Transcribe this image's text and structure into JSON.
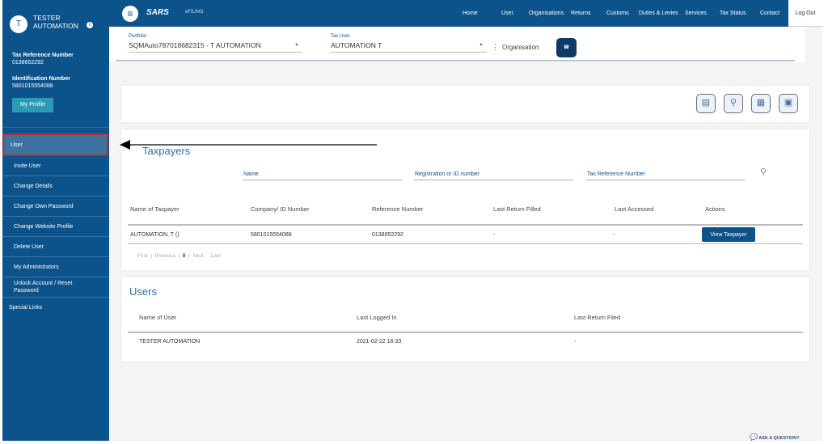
{
  "sidebar": {
    "avatar_letter": "T",
    "user_name_1": "TESTER",
    "user_name_2": "AUTOMATION",
    "tax_ref_label": "Tax Reference Number",
    "tax_ref": "0138652292",
    "id_label": "Identification Number",
    "id_number": "5801015554088",
    "profile_button": "My Profile",
    "active_item": "User",
    "items": [
      "Invite User",
      "Change Details",
      "Change Own Password",
      "Change Website Profile",
      "Delete User",
      "My Administrators",
      "Unlock Account / Reset Password",
      "Special Links"
    ]
  },
  "topbar": {
    "logo": "SARS",
    "efiling": "eFILING",
    "nav": [
      "Home",
      "User",
      "Organisations",
      "Returns",
      "Customs",
      "Duties & Levies",
      "Services",
      "Tax Status",
      "Contact"
    ],
    "logout": "Log Out"
  },
  "filters": {
    "portfolio_label": "Portfolio",
    "portfolio_value": "SQMAuto787018682315 - T AUTOMATION",
    "tax_user_label": "Tax User",
    "tax_user_value": "AUTOMATION T",
    "organisation": "Organisation"
  },
  "taxpayers": {
    "title": "Taxpayers",
    "search": {
      "name": "Name",
      "registration": "Registration or ID number",
      "tax_ref": "Tax Reference Number"
    },
    "columns": [
      "Name of Taxpayer",
      "Company/ ID Number",
      "Reference Number",
      "Last Return Filled",
      "Last Accessed",
      "Actions"
    ],
    "rows": [
      {
        "name": "AUTOMATION, T ()",
        "id": "5801015554088",
        "ref": "0138652292",
        "last_return": "-",
        "last_accessed": "-",
        "action": "View Taxpayer"
      }
    ],
    "pagination": {
      "first": "First",
      "previous": "Previous",
      "page": "0",
      "next": "Next",
      "last": "Last"
    }
  },
  "users": {
    "title": "Users",
    "columns": [
      "Name of User",
      "Last Logged In",
      "Last Return Filed"
    ],
    "rows": [
      {
        "name": "TESTER AUTOMATION",
        "last_login": "2021-02-22 16:33",
        "last_return": "-"
      }
    ]
  },
  "help": {
    "ask": "ASK A QUESTION?"
  },
  "colors": {
    "primary": "#0d538b",
    "highlight": "#c0282f"
  }
}
